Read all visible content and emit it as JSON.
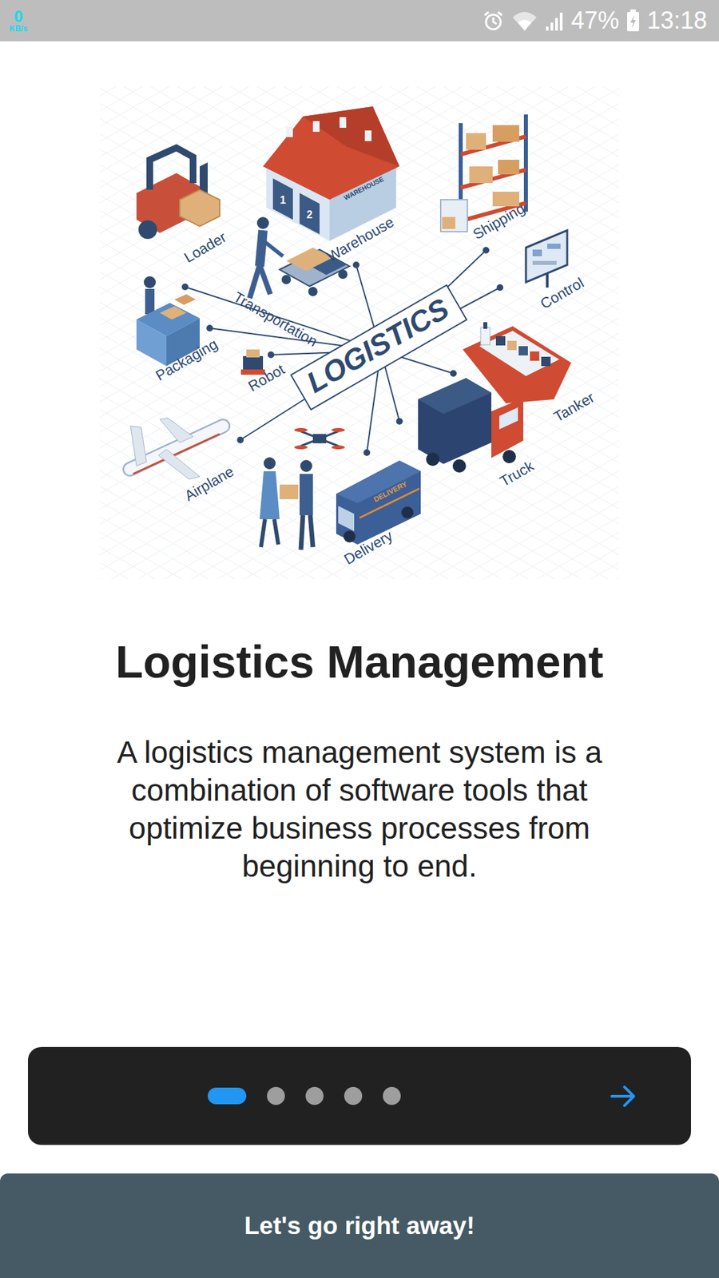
{
  "status_bar": {
    "speed": "0",
    "speed_unit": "KB/s",
    "battery": "47%",
    "time": "13:18"
  },
  "illustration": {
    "center": "LOGISTICS",
    "nodes": [
      "Loader",
      "Warehouse",
      "Shipping",
      "Control",
      "Transportation",
      "Packaging",
      "Robot",
      "Tanker",
      "Truck",
      "Airplane",
      "Delivery"
    ],
    "warehouse_sign": "WAREHOUSE",
    "warehouse_doors": [
      "1",
      "2"
    ],
    "van_sign": "DELIVERY"
  },
  "onboarding": {
    "title": "Logistics Management",
    "description": "A logistics management system is a combination of software tools that optimize business processes from beginning to end."
  },
  "pager": {
    "pages": [
      {
        "selected": true
      },
      {
        "selected": false
      },
      {
        "selected": false
      },
      {
        "selected": false
      },
      {
        "selected": false
      }
    ]
  },
  "button": {
    "label": "Let's go right away!"
  }
}
